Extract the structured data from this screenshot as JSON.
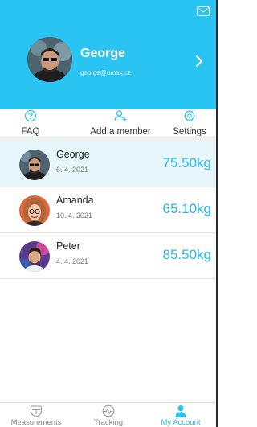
{
  "colors": {
    "accent": "#29c4f2",
    "weight_text": "#2ab8e8",
    "selected_row": "#e6f6fb"
  },
  "profile": {
    "name": "George",
    "email": "george@umax.cz"
  },
  "actions": [
    {
      "label": "FAQ",
      "icon": "question-circle-icon"
    },
    {
      "label": "Add a member",
      "icon": "add-user-icon"
    },
    {
      "label": "Settings",
      "icon": "gear-icon"
    }
  ],
  "members": [
    {
      "name": "George",
      "date": "6. 4. 2021",
      "weight": "75.50kg",
      "selected": true
    },
    {
      "name": "Amanda",
      "date": "10. 4. 2021",
      "weight": "65.10kg",
      "selected": false
    },
    {
      "name": "Peter",
      "date": "4. 4. 2021",
      "weight": "85.50kg",
      "selected": false
    }
  ],
  "nav": [
    {
      "label": "Measurements",
      "icon": "shield-scale-icon",
      "active": false
    },
    {
      "label": "Tracking",
      "icon": "pulse-icon",
      "active": false
    },
    {
      "label": "My Account",
      "icon": "person-icon",
      "active": true
    }
  ]
}
